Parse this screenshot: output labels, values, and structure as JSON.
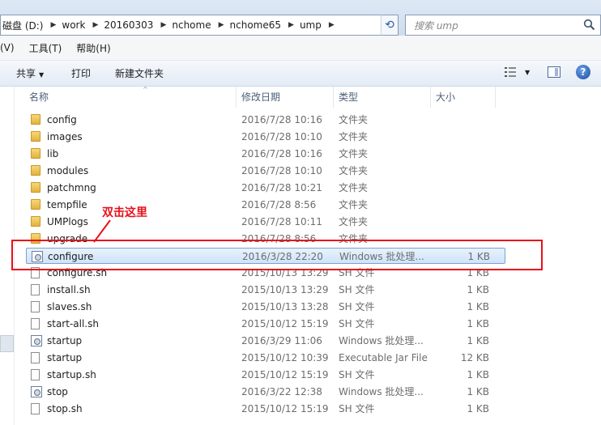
{
  "address": {
    "crumbs": [
      "磁盘 (D:)",
      "work",
      "20160303",
      "nchome",
      "nchome65",
      "ump"
    ]
  },
  "search": {
    "placeholder": "搜索 ump"
  },
  "menu": [
    "(V)",
    "工具(T)",
    "帮助(H)"
  ],
  "toolbar": {
    "share": "共享",
    "print": "打印",
    "new_folder": "新建文件夹"
  },
  "columns": {
    "name": "名称",
    "modified": "修改日期",
    "type": "类型",
    "size": "大小"
  },
  "files": [
    {
      "name": "config",
      "date": "2016/7/28 10:16",
      "type": "文件夹",
      "size": "",
      "icon": "folder"
    },
    {
      "name": "images",
      "date": "2016/7/28 10:10",
      "type": "文件夹",
      "size": "",
      "icon": "folder"
    },
    {
      "name": "lib",
      "date": "2016/7/28 10:16",
      "type": "文件夹",
      "size": "",
      "icon": "folder"
    },
    {
      "name": "modules",
      "date": "2016/7/28 10:10",
      "type": "文件夹",
      "size": "",
      "icon": "folder"
    },
    {
      "name": "patchmng",
      "date": "2016/7/28 10:21",
      "type": "文件夹",
      "size": "",
      "icon": "folder"
    },
    {
      "name": "tempfile",
      "date": "2016/7/28 8:56",
      "type": "文件夹",
      "size": "",
      "icon": "folder"
    },
    {
      "name": "UMPlogs",
      "date": "2016/7/28 10:11",
      "type": "文件夹",
      "size": "",
      "icon": "folder"
    },
    {
      "name": "upgrade",
      "date": "2016/7/28 8:56",
      "type": "文件夹",
      "size": "",
      "icon": "folder"
    },
    {
      "name": "configure",
      "date": "2016/3/28 22:20",
      "type": "Windows 批处理...",
      "size": "1 KB",
      "icon": "batch"
    },
    {
      "name": "configure.sh",
      "date": "2015/10/13 13:29",
      "type": "SH 文件",
      "size": "1 KB",
      "icon": "document"
    },
    {
      "name": "install.sh",
      "date": "2015/10/13 13:29",
      "type": "SH 文件",
      "size": "1 KB",
      "icon": "document"
    },
    {
      "name": "slaves.sh",
      "date": "2015/10/13 13:28",
      "type": "SH 文件",
      "size": "1 KB",
      "icon": "document"
    },
    {
      "name": "start-all.sh",
      "date": "2015/10/12 15:19",
      "type": "SH 文件",
      "size": "1 KB",
      "icon": "document"
    },
    {
      "name": "startup",
      "date": "2016/3/29 11:06",
      "type": "Windows 批处理...",
      "size": "1 KB",
      "icon": "batch"
    },
    {
      "name": "startup",
      "date": "2015/10/12 10:39",
      "type": "Executable Jar File",
      "size": "12 KB",
      "icon": "document"
    },
    {
      "name": "startup.sh",
      "date": "2015/10/12 15:19",
      "type": "SH 文件",
      "size": "1 KB",
      "icon": "document"
    },
    {
      "name": "stop",
      "date": "2016/3/22 12:38",
      "type": "Windows 批处理...",
      "size": "1 KB",
      "icon": "batch"
    },
    {
      "name": "stop.sh",
      "date": "2015/10/12 15:19",
      "type": "SH 文件",
      "size": "1 KB",
      "icon": "document"
    }
  ],
  "selected_index": 8,
  "annotation": {
    "text": "双击这里",
    "color": "#e8101a"
  },
  "colors": {
    "selection": "#cfe3fb",
    "folder": "#e3b23c",
    "annotation": "#e8101a"
  }
}
